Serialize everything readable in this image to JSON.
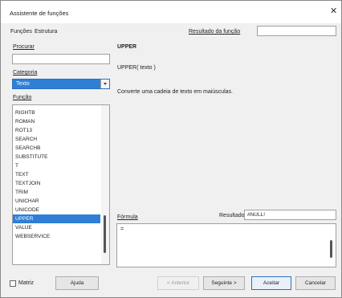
{
  "window": {
    "title": "Assistente de funções",
    "close_glyph": "✕"
  },
  "tabs": {
    "functions": "Funções",
    "structure": "Estrutura"
  },
  "left": {
    "search_label": "Procurar",
    "search_value": "",
    "category_label": "Categoria",
    "category_value": "Texto",
    "function_label": "Função",
    "functions": [
      "RIGHTB",
      "ROMAN",
      "ROT13",
      "SEARCH",
      "SEARCHB",
      "SUBSTITUTE",
      "T",
      "TEXT",
      "TEXTJOIN",
      "TRIM",
      "UNICHAR",
      "UNICODE",
      "UPPER",
      "VALUE",
      "WEBSERVICE"
    ],
    "selected_index": 12
  },
  "right": {
    "function_result_label": "Resultado da função",
    "function_result_value": "",
    "function_name": "UPPER",
    "signature": "UPPER( texto )",
    "description": "Converte uma cadeia de texto em maiúsculas.",
    "formula_label": "Fórmula",
    "result_label": "Resultado",
    "result_value": "#NULL!",
    "formula_value": "="
  },
  "footer": {
    "array_label": "Matriz",
    "help": "Ajuda",
    "back": "< Anterior",
    "next": "Seguinte >",
    "ok": "Aceitar",
    "cancel": "Cancelar"
  }
}
